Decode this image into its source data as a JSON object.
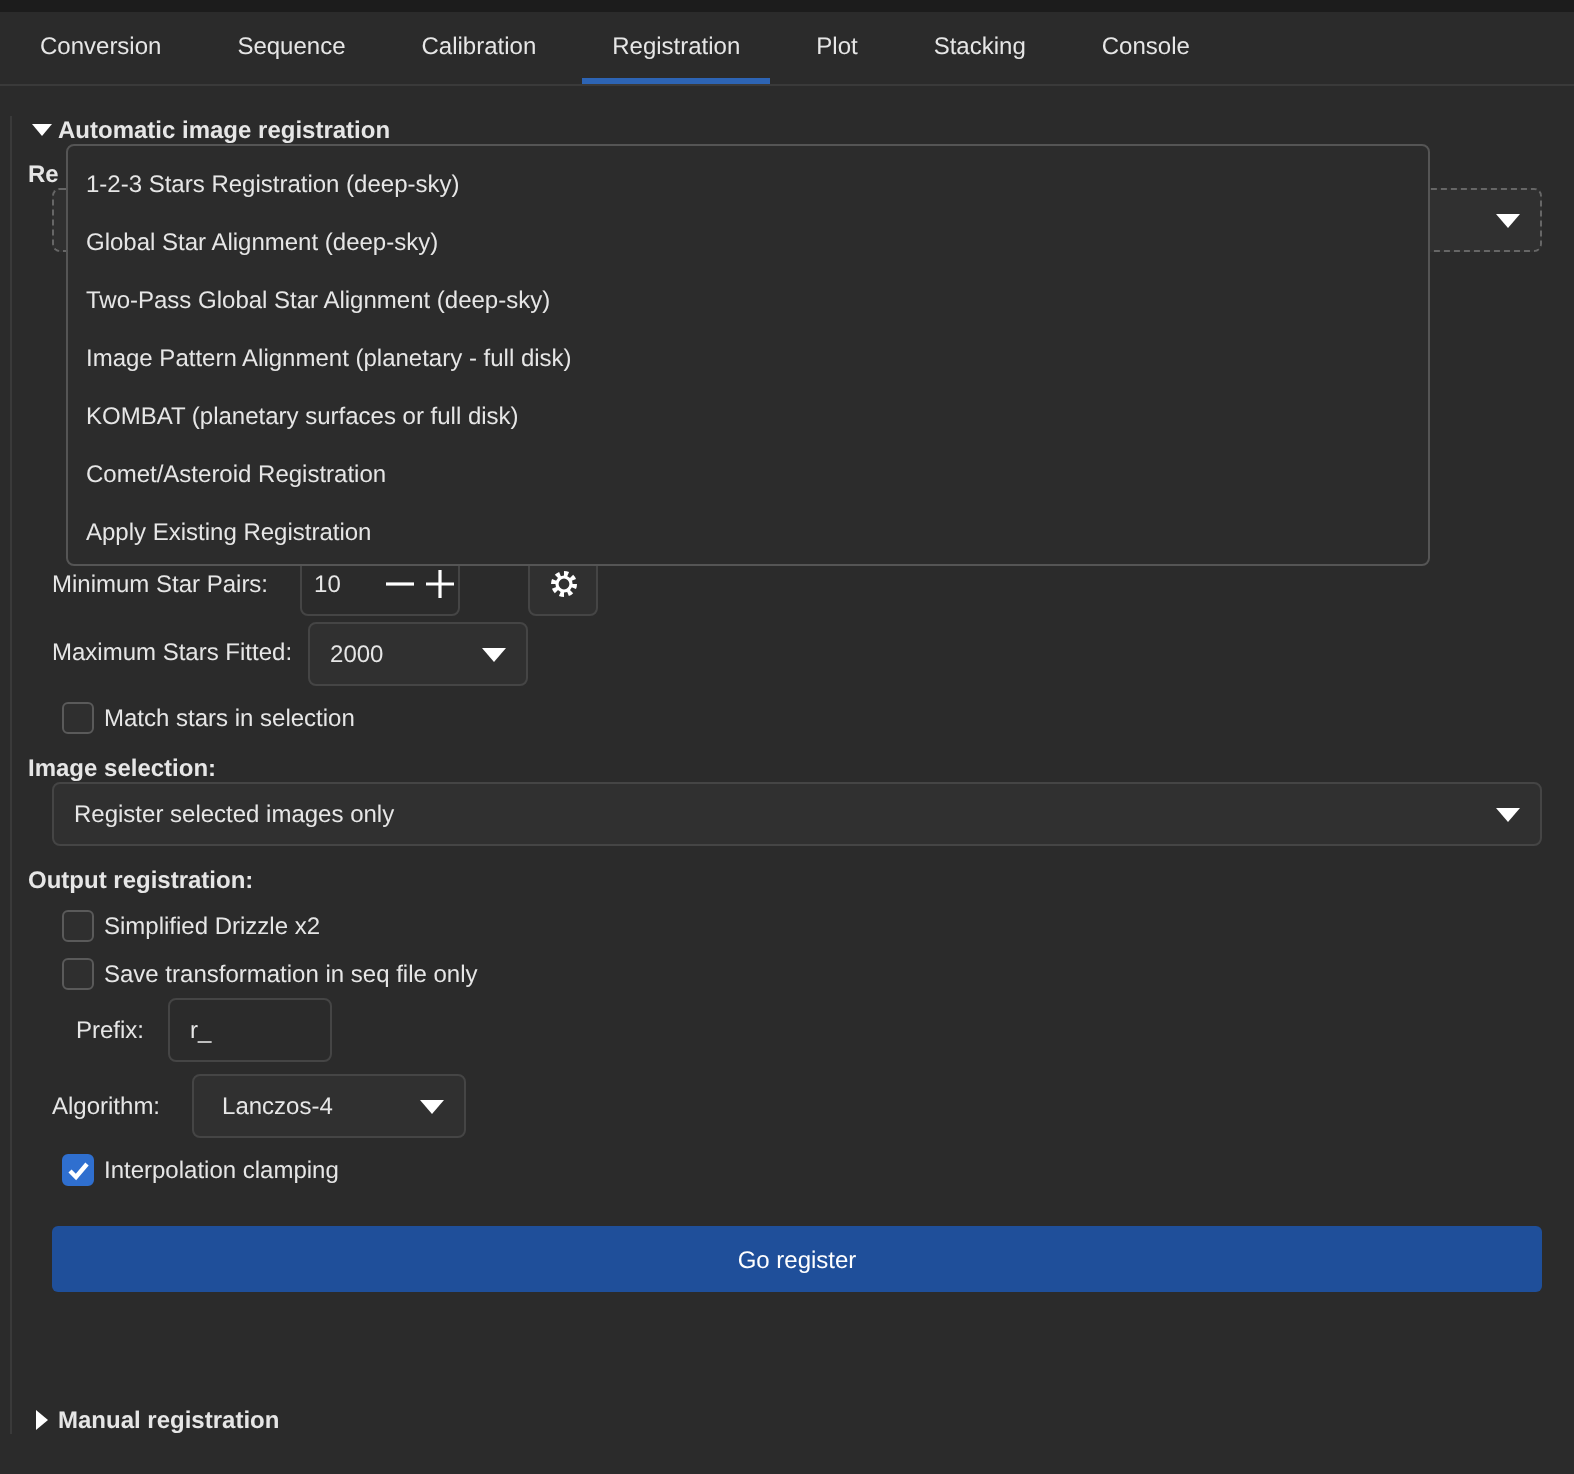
{
  "tabs": [
    {
      "label": "Conversion",
      "selected": false
    },
    {
      "label": "Sequence",
      "selected": false
    },
    {
      "label": "Calibration",
      "selected": false
    },
    {
      "label": "Registration",
      "selected": true
    },
    {
      "label": "Plot",
      "selected": false
    },
    {
      "label": "Stacking",
      "selected": false
    },
    {
      "label": "Console",
      "selected": false
    }
  ],
  "automatic": {
    "title": "Automatic image registration",
    "expanded": true,
    "method_label": "Re",
    "min_star_pairs": {
      "label": "Minimum Star Pairs:",
      "value": "10"
    },
    "max_stars_fitted": {
      "label": "Maximum Stars Fitted:",
      "value": "2000"
    },
    "match_in_selection": {
      "label": "Match stars in selection",
      "checked": false
    },
    "image_selection": {
      "title": "Image selection:",
      "value": "Register selected images only"
    },
    "output": {
      "title": "Output registration:",
      "options": [
        {
          "label": "Simplified Drizzle x2",
          "checked": false
        },
        {
          "label": "Save transformation in seq file only",
          "checked": false
        }
      ],
      "prefix": {
        "label": "Prefix:",
        "value": "r_"
      },
      "algorithm": {
        "label": "Algorithm:",
        "value": "Lanczos-4"
      },
      "clamping": {
        "label": "Interpolation clamping",
        "checked": true
      }
    },
    "go_button": "Go register"
  },
  "method_menu": [
    "1-2-3 Stars Registration (deep-sky)",
    "Global Star Alignment (deep-sky)",
    "Two-Pass Global Star Alignment (deep-sky)",
    "Image Pattern Alignment (planetary - full disk)",
    "KOMBAT (planetary surfaces or full disk)",
    "Comet/Asteroid Registration",
    "Apply Existing Registration"
  ],
  "manual": {
    "title": "Manual registration",
    "expanded": false
  }
}
